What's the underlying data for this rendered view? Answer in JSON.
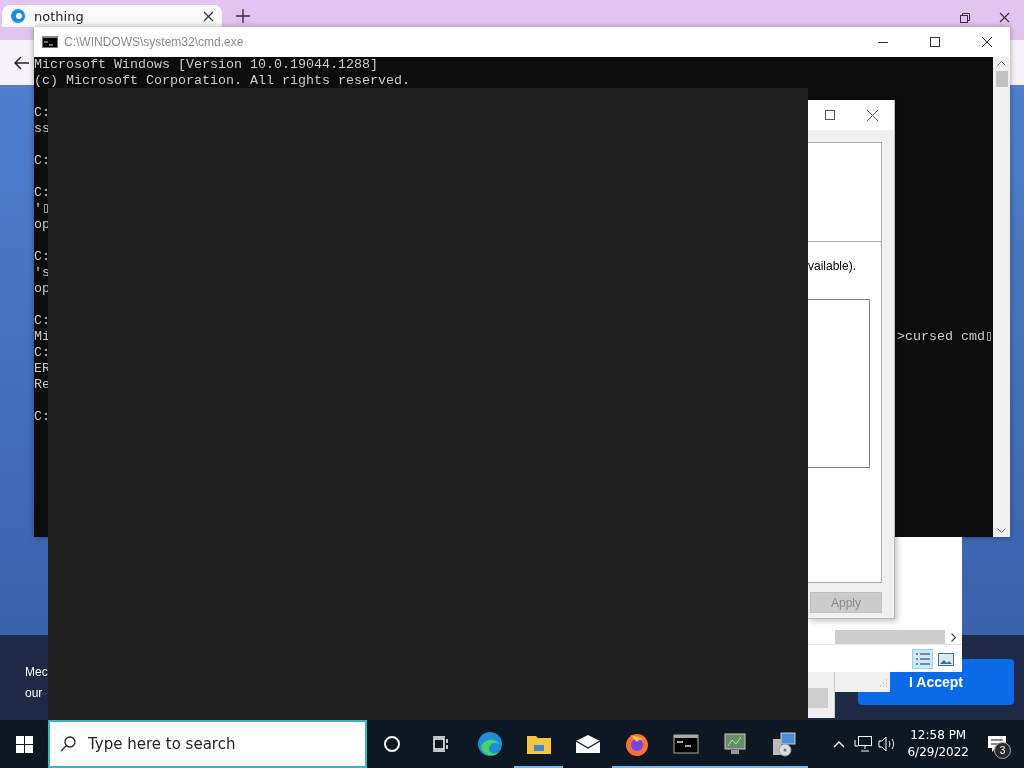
{
  "browser": {
    "tab": {
      "title": "nothing"
    },
    "cookie_banner": {
      "lines": [
        "Mec",
        "our"
      ],
      "accept_button": "I Accept"
    }
  },
  "cmd_window": {
    "title": "C:\\WINDOWS\\system32\\cmd.exe",
    "blocks": [
      [
        {
          "text": "Microsoft Windows [Version 10.0.19044.1288]"
        },
        {
          "text": "(c) Microsoft Corporation. All rights reserved."
        }
      ],
      [
        {
          "text": "C:"
        },
        {
          "text": "ss"
        }
      ],
      [
        {
          "text": "C:"
        }
      ],
      [
        {
          "text": "C:"
        },
        {
          "text": "'▯"
        },
        {
          "text": "op"
        }
      ],
      [
        {
          "text": "C:"
        },
        {
          "text": "'s"
        },
        {
          "text": "op"
        }
      ],
      [
        {
          "text": "C:"
        },
        {
          "text": "Mi",
          "tail": ">cursed cmd▯"
        },
        {
          "text": "C:"
        },
        {
          "text": "ER"
        },
        {
          "text": "Re"
        }
      ],
      [
        {
          "text": "C:"
        }
      ]
    ]
  },
  "properties_dialog": {
    "text": "vailable).",
    "apply_button": {
      "label": "Apply",
      "disabled": true
    }
  },
  "explorer_window": {
    "views": [
      {
        "kind": "details",
        "selected": true
      },
      {
        "kind": "preview",
        "selected": false
      }
    ]
  },
  "taskbar": {
    "search": {
      "placeholder": "Type here to search"
    },
    "apps": [
      {
        "kind": "cortana",
        "running": false
      },
      {
        "kind": "task_view",
        "running": false
      },
      {
        "kind": "edge",
        "running": false
      },
      {
        "kind": "explorer",
        "running": true
      },
      {
        "kind": "mail",
        "running": false
      },
      {
        "kind": "firefox",
        "running": true
      },
      {
        "kind": "terminal",
        "running": true
      },
      {
        "kind": "monitor",
        "running": true
      },
      {
        "kind": "control_panel",
        "running": true
      }
    ],
    "clock": {
      "time": "12:58 PM",
      "date": "6/29/2022"
    },
    "notifications": {
      "count": "3"
    }
  }
}
